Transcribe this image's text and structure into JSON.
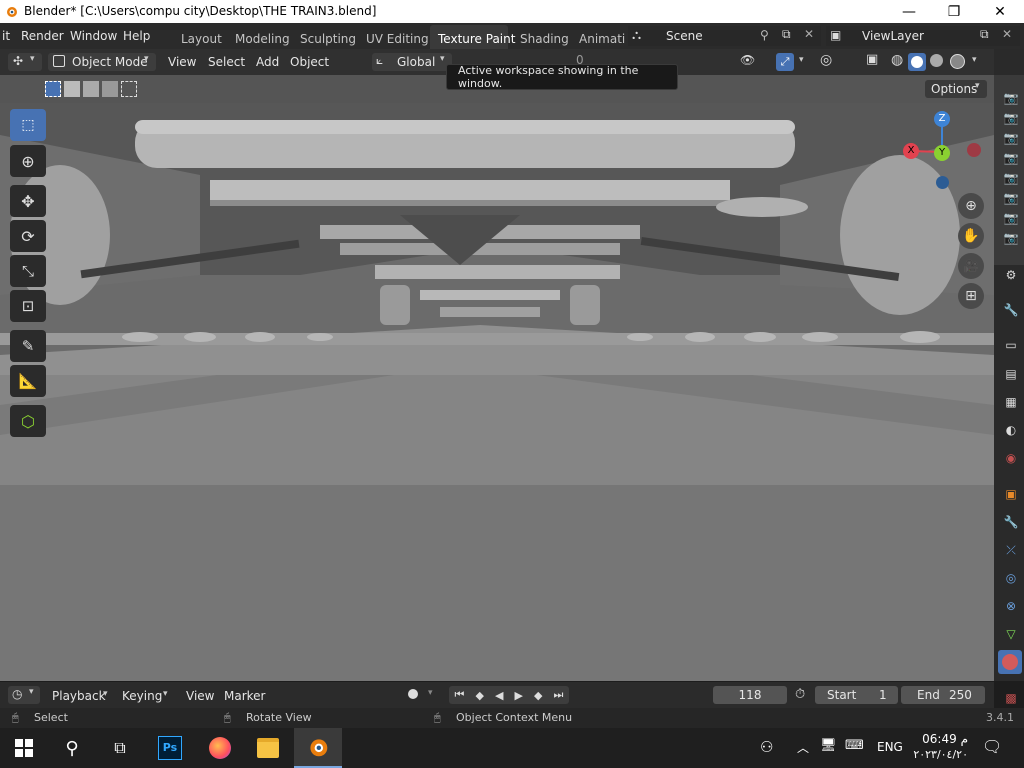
{
  "window": {
    "title": "Blender* [C:\\Users\\compu city\\Desktop\\THE TRAIN3.blend]",
    "controls": {
      "minimize": "—",
      "maximize": "❐",
      "close": "✕"
    }
  },
  "topbar": {
    "menus": [
      "it",
      "Render",
      "Window",
      "Help"
    ],
    "workspaces": [
      "Layout",
      "Modeling",
      "Sculpting",
      "UV Editing",
      "Texture Paint",
      "Shading",
      "Animati"
    ],
    "active_workspace": "Texture Paint",
    "scene": "Scene",
    "view_layer": "ViewLayer"
  },
  "header": {
    "mode": "Object Mode",
    "menus": [
      "View",
      "Select",
      "Add",
      "Object"
    ],
    "transform_orientation": "Global",
    "snap_increment": "0",
    "options_label": "Options"
  },
  "tooltip": "Active workspace showing in the window.",
  "gizmo": {
    "x": "X",
    "y": "Y",
    "z": "Z"
  },
  "colors": {
    "accent": "#4772b3",
    "x_axis": "#e2424f",
    "y_axis": "#8ad131",
    "z_axis": "#3e84d6",
    "active_workspace_bg": "#3a3a3a"
  },
  "toolbar_tools": [
    {
      "name": "select-box",
      "icon": "cursor-select-icon",
      "selected": true
    },
    {
      "name": "cursor",
      "icon": "3d-cursor-icon"
    },
    {
      "name": "move",
      "icon": "move-icon"
    },
    {
      "name": "rotate",
      "icon": "rotate-icon"
    },
    {
      "name": "scale",
      "icon": "scale-icon"
    },
    {
      "name": "transform",
      "icon": "transform-icon"
    },
    {
      "name": "annotate",
      "icon": "annotate-icon"
    },
    {
      "name": "measure",
      "icon": "measure-icon"
    },
    {
      "name": "add-cube",
      "icon": "add-cube-icon"
    }
  ],
  "timeline": {
    "menus": [
      "Playback",
      "Keying",
      "View",
      "Marker"
    ],
    "current_frame": "118",
    "start_label": "Start",
    "start_value": "1",
    "end_label": "End",
    "end_value": "250"
  },
  "statusbar": {
    "left": "Select",
    "middle": "Rotate View",
    "right": "Object Context Menu",
    "version": "3.4.1"
  },
  "taskbar": {
    "lang": "ENG",
    "time": "06:49 م",
    "date": "٢٠٢٣/٠٤/٢٠"
  }
}
